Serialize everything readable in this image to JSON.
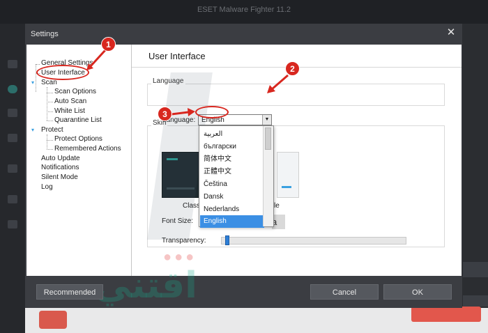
{
  "background_app": {
    "title": "ESET Malware Fighter 11.2"
  },
  "dialog": {
    "title": "Settings",
    "close_glyph": "✕",
    "tree": [
      {
        "label": "General Settings"
      },
      {
        "label": "User Interface"
      },
      {
        "label": "Scan"
      },
      {
        "label": "Scan Options"
      },
      {
        "label": "Auto Scan"
      },
      {
        "label": "White List"
      },
      {
        "label": "Quarantine List"
      },
      {
        "label": "Protect"
      },
      {
        "label": "Protect Options"
      },
      {
        "label": "Remembered Actions"
      },
      {
        "label": "Auto Update"
      },
      {
        "label": "Notifications"
      },
      {
        "label": "Silent Mode"
      },
      {
        "label": "Log"
      }
    ],
    "panel": {
      "title": "User Interface",
      "language_group": "Language",
      "language_label": "Language:",
      "language_value": "English",
      "skin_group": "Skin",
      "skin_left_caption": "Class",
      "skin_right_caption": "le",
      "font_size_label": "Font Size:",
      "font_preview": "a",
      "transparency_label": "Transparency:",
      "transparency_value": 0.02
    },
    "dropdown": {
      "items": [
        "العربية",
        "български",
        "简体中文",
        "正體中文",
        "Čeština",
        "Dansk",
        "Nederlands",
        "English"
      ],
      "selected": "English"
    },
    "footer": {
      "recommended_label": "Recommended",
      "cancel_label": "Cancel",
      "ok_label": "OK"
    }
  },
  "annotations": {
    "step1": "1",
    "step2": "2",
    "step3": "3",
    "color": "#d8271f"
  },
  "watermark": {
    "text": "اقتني"
  }
}
